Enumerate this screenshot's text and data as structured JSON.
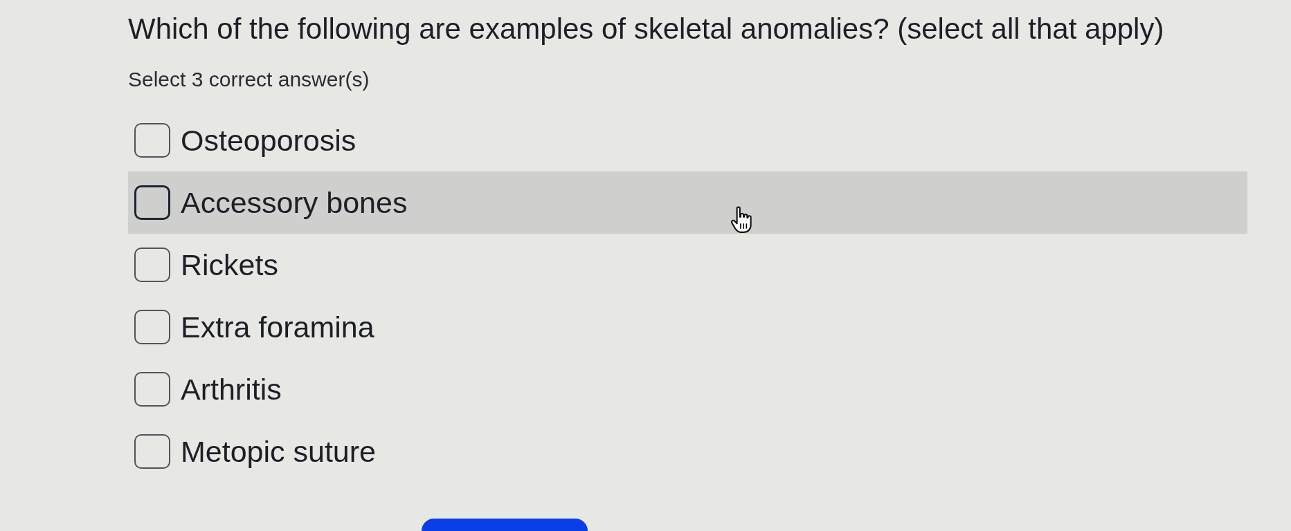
{
  "question": {
    "title": "Which of the following are examples of skeletal anomalies? (select all that apply)",
    "instruction": "Select 3 correct answer(s)"
  },
  "options": [
    {
      "label": "Osteoporosis",
      "checked": false,
      "hovered": false
    },
    {
      "label": "Accessory bones",
      "checked": false,
      "hovered": true
    },
    {
      "label": "Rickets",
      "checked": false,
      "hovered": false
    },
    {
      "label": "Extra foramina",
      "checked": false,
      "hovered": false
    },
    {
      "label": "Arthritis",
      "checked": false,
      "hovered": false
    },
    {
      "label": "Metopic suture",
      "checked": false,
      "hovered": false
    }
  ]
}
